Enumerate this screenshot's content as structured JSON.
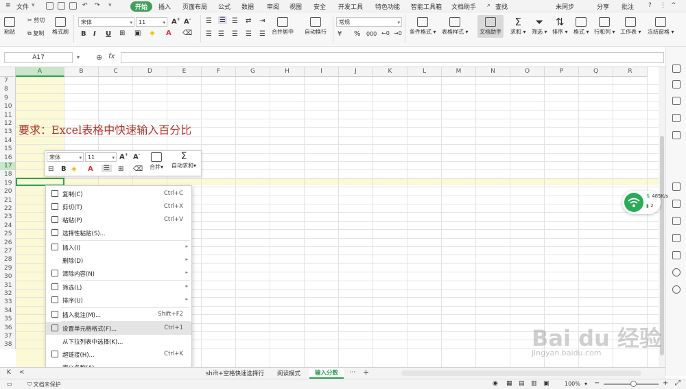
{
  "menubar": {
    "file": "文件",
    "tabs": [
      "开始",
      "插入",
      "页面布局",
      "公式",
      "数据",
      "审阅",
      "视图",
      "安全",
      "开发工具",
      "特色功能",
      "智能工具箱",
      "文档助手"
    ],
    "search": "查找",
    "right": {
      "sync": "未同步",
      "share": "分享",
      "comment": "批注"
    }
  },
  "ribbon": {
    "paste": "粘贴",
    "cut": "剪切",
    "copy": "复制",
    "format_painter": "格式刷",
    "font_name": "宋体",
    "font_size": "11",
    "merge_center": "合并居中",
    "auto_wrap": "自动换行",
    "number_format": "常规",
    "cond_format": "条件格式",
    "table_style": "表格样式",
    "doc_assistant": "文档助手",
    "sum": "求和",
    "filter": "筛选",
    "sort": "排序",
    "format": "格式",
    "row_col": "行和列",
    "worksheet": "工作表",
    "freeze": "冻结窗格",
    "percent": "%",
    "number_group": "000"
  },
  "formula_bar": {
    "cell_ref": "A17",
    "fx": "fx"
  },
  "columns": [
    "A",
    "B",
    "C",
    "D",
    "E",
    "F",
    "G",
    "H",
    "I",
    "J",
    "K",
    "L",
    "M",
    "N",
    "O",
    "P",
    "Q",
    "R"
  ],
  "rows": [
    "7",
    "8",
    "9",
    "10",
    "11",
    "12",
    "13",
    "14",
    "15",
    "16",
    "17",
    "18",
    "19",
    "20",
    "21",
    "22",
    "23",
    "24",
    "25",
    "26",
    "27",
    "28",
    "29",
    "30",
    "31",
    "32",
    "33",
    "34",
    "35",
    "36",
    "37",
    "38"
  ],
  "cell_a12": "要求：Excel表格中快速输入百分比",
  "mini_toolbar": {
    "font_name": "宋体",
    "font_size": "11",
    "merge": "合并",
    "autosum": "自动求和"
  },
  "context_menu": [
    {
      "label": "复制(C)",
      "shortcut": "Ctrl+C",
      "icon": "copy-icon",
      "arrow": false
    },
    {
      "label": "剪切(T)",
      "shortcut": "Ctrl+X",
      "icon": "cut-icon",
      "arrow": false
    },
    {
      "label": "粘贴(P)",
      "shortcut": "Ctrl+V",
      "icon": "paste-icon",
      "arrow": false
    },
    {
      "label": "选择性粘贴(S)...",
      "shortcut": "",
      "icon": "paste-special-icon",
      "arrow": false
    },
    {
      "label": "插入(I)",
      "shortcut": "",
      "icon": "insert-icon",
      "arrow": true
    },
    {
      "label": "删除(D)",
      "shortcut": "",
      "icon": "",
      "arrow": true
    },
    {
      "label": "清除内容(N)",
      "shortcut": "",
      "icon": "clear-icon",
      "arrow": true
    },
    {
      "label": "筛选(L)",
      "shortcut": "",
      "icon": "filter-icon",
      "arrow": true
    },
    {
      "label": "排序(U)",
      "shortcut": "",
      "icon": "sort-icon",
      "arrow": true
    },
    {
      "label": "插入批注(M)...",
      "shortcut": "Shift+F2",
      "icon": "comment-icon",
      "arrow": false
    },
    {
      "label": "设置单元格格式(F)...",
      "shortcut": "Ctrl+1",
      "icon": "format-cells-icon",
      "arrow": false
    },
    {
      "label": "从下拉列表中选择(K)...",
      "shortcut": "",
      "icon": "",
      "arrow": false
    },
    {
      "label": "超链接(H)...",
      "shortcut": "Ctrl+K",
      "icon": "link-icon",
      "arrow": false
    },
    {
      "label": "定义名称(A)...",
      "shortcut": "",
      "icon": "",
      "arrow": false
    }
  ],
  "sheet_tabs": {
    "tab1": "shift+空格快速选择行",
    "tab2": "阅读模式",
    "tab3": "输入分数",
    "more": "···",
    "add": "+"
  },
  "status": {
    "doc_protect": "文档未保护",
    "zoom": "100%"
  },
  "net_widget": {
    "speed": "485K/s",
    "count": "2"
  },
  "watermark": {
    "brand": "Bai du 经验",
    "url": "jingyan.baidu.com"
  },
  "colors": {
    "accent": "#2f9e51",
    "title_red": "#b3322a",
    "highlight": "#fbf9d6"
  }
}
